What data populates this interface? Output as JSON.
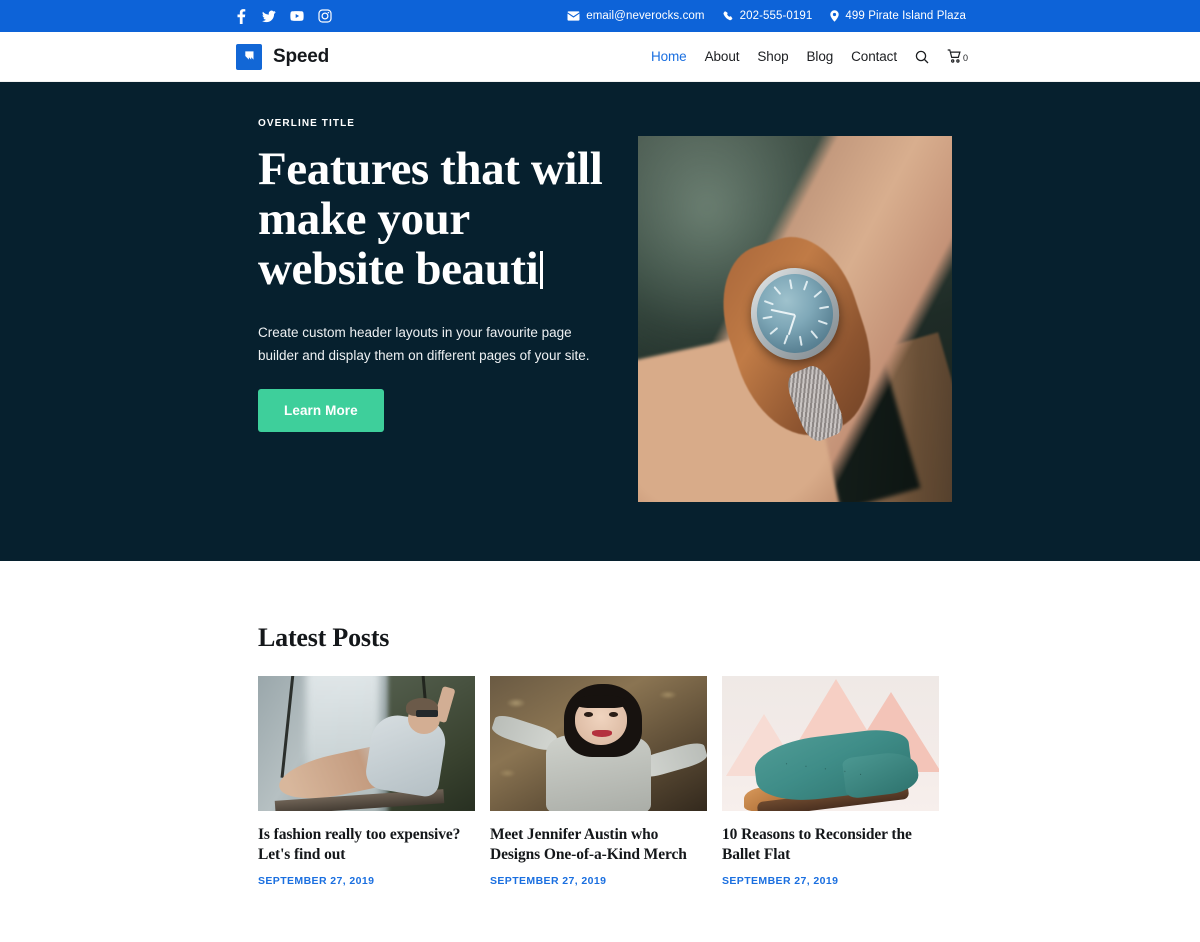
{
  "topbar": {
    "social": [
      {
        "name": "facebook-icon",
        "label": "Facebook"
      },
      {
        "name": "twitter-icon",
        "label": "Twitter"
      },
      {
        "name": "youtube-icon",
        "label": "YouTube"
      },
      {
        "name": "instagram-icon",
        "label": "Instagram"
      }
    ],
    "email": "email@neverocks.com",
    "phone": "202-555-0191",
    "address": "499 Pirate Island Plaza",
    "background_color": "#0d63d8"
  },
  "header": {
    "brand_name": "Speed",
    "brand_icon": "flag-arrow-icon",
    "brand_color": "#1267d6",
    "nav": [
      {
        "label": "Home",
        "active": true
      },
      {
        "label": "About",
        "active": false
      },
      {
        "label": "Shop",
        "active": false
      },
      {
        "label": "Blog",
        "active": false
      },
      {
        "label": "Contact",
        "active": false
      }
    ],
    "search_icon": "search-icon",
    "cart_icon": "cart-icon",
    "cart_count": "0",
    "active_color": "#1a6fe0"
  },
  "hero": {
    "overline": "OVERLINE TITLE",
    "title_line_1": "Features that will",
    "title_line_2": "make your",
    "title_line_3": "website beauti",
    "subtitle": "Create custom header layouts in your favourite page builder and display them on different pages of your site.",
    "button_label": "Learn More",
    "button_color": "#3ecf9b",
    "background_color": "#06202e",
    "image_alt": "wristwatch on a man's wrist"
  },
  "posts_section": {
    "title": "Latest Posts",
    "posts": [
      {
        "title": "Is fashion really too expensive? Let's find out",
        "date": "SEPTEMBER 27, 2019",
        "image_alt": "woman sitting on a swing in front of a waterfall"
      },
      {
        "title": "Meet Jennifer Austin who Designs One-of-a-Kind Merch",
        "date": "SEPTEMBER 27, 2019",
        "image_alt": "smiling woman with dark hair outdoors in autumn"
      },
      {
        "title": "10 Reasons to Reconsider the Ballet Flat",
        "date": "SEPTEMBER 27, 2019",
        "image_alt": "teal suede brogue shoe on pink geometric background"
      }
    ],
    "date_color": "#1a6fe0"
  }
}
